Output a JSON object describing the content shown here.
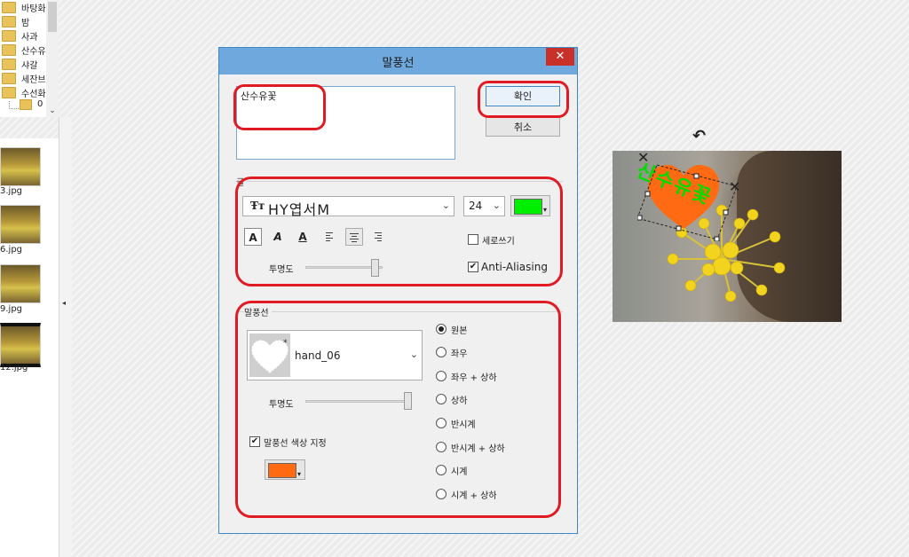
{
  "tree": {
    "items": [
      "바탕화",
      "밤",
      "사과",
      "산수유",
      "샤갈",
      "세잔브",
      "수선화"
    ],
    "sub_item": "0",
    "scroll_arrow": "⌄"
  },
  "thumbnails": [
    {
      "name": "3.jpg"
    },
    {
      "name": "6.jpg"
    },
    {
      "name": "9.jpg"
    },
    {
      "name": "12.jpg"
    }
  ],
  "dialog": {
    "title": "말풍선",
    "close_label": "✕",
    "text_value": "산수유꽃",
    "ok_label": "확인",
    "cancel_label": "취소",
    "font_group_label": "글",
    "font_icon": "Ŧт",
    "font_name": "HY엽서M",
    "font_size": "24",
    "font_color": "#00ee00",
    "style_bold": "A",
    "style_italic": "A",
    "style_underline": "A",
    "vertical_label": "세로쓰기",
    "anti_alias_label": "Anti-Aliasing",
    "anti_alias_checked": "✔",
    "opacity_label": "투명도",
    "text_opacity_fraction": 0.95,
    "bubble_group_label": "말풍선",
    "bubble_shape_name": "hand_06",
    "bubble_opacity_fraction": 1.0,
    "bubble_color_label": "말풍선 색상 지정",
    "bubble_color_checked": "✔",
    "bubble_color": "#ff6a13",
    "flip_options": [
      "원본",
      "좌우",
      "좌우 + 상하",
      "상하",
      "반시계",
      "반시계 + 상하",
      "시계",
      "시계 + 상하"
    ],
    "flip_selected": 0
  },
  "preview": {
    "bubble_text": "산수유꽃",
    "rotate_glyph": "↶",
    "handle_glyph": "✕"
  },
  "colors": {
    "title_bar": "#6fa8dc",
    "close": "#c7312a",
    "annotation_red": "#e11b24"
  }
}
